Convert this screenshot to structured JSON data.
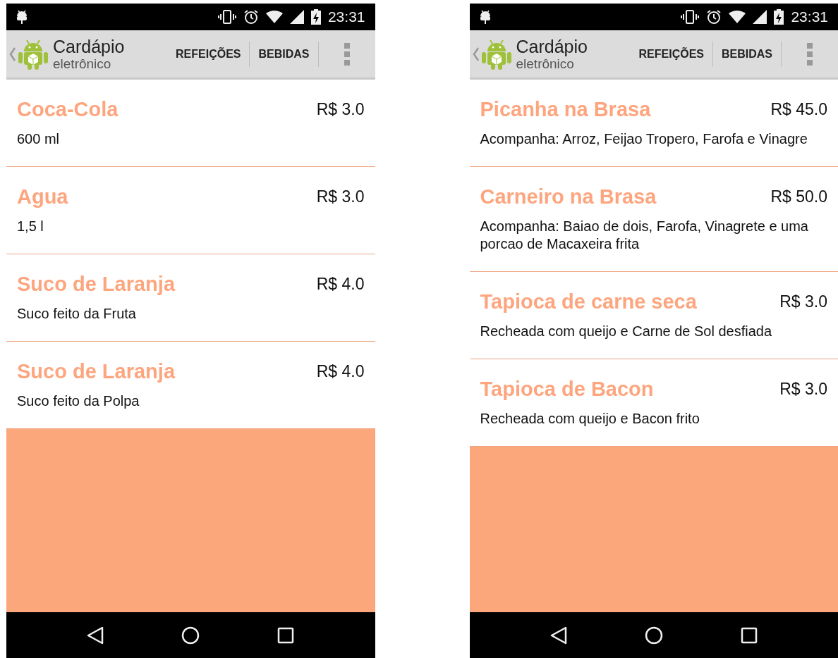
{
  "phones": [
    {
      "status_bar": {
        "time": "23:31"
      },
      "action_bar": {
        "title": "Cardápio",
        "subtitle": "eletrônico",
        "tabs": [
          "REFEIÇÕES",
          "BEBIDAS"
        ]
      },
      "items": [
        {
          "name": "Coca-Cola",
          "price": "R$ 3.0",
          "description": "600 ml"
        },
        {
          "name": "Agua",
          "price": "R$ 3.0",
          "description": "1,5 l"
        },
        {
          "name": "Suco de Laranja",
          "price": "R$ 4.0",
          "description": "Suco feito da Fruta"
        },
        {
          "name": "Suco de Laranja",
          "price": "R$ 4.0",
          "description": "Suco feito da Polpa"
        }
      ]
    },
    {
      "status_bar": {
        "time": "23:31"
      },
      "action_bar": {
        "title": "Cardápio",
        "subtitle": "eletrônico",
        "tabs": [
          "REFEIÇÕES",
          "BEBIDAS"
        ]
      },
      "items": [
        {
          "name": "Picanha na Brasa",
          "price": "R$ 45.0",
          "description": "Acompanha: Arroz, Feijao Tropero, Farofa e Vinagre"
        },
        {
          "name": "Carneiro na Brasa",
          "price": "R$ 50.0",
          "description": "Acompanha: Baiao de dois, Farofa, Vinagrete e uma porcao de Macaxeira frita"
        },
        {
          "name": "Tapioca de carne seca",
          "price": "R$ 3.0",
          "description": "Recheada com queijo e Carne de Sol desfiada"
        },
        {
          "name": "Tapioca de Bacon",
          "price": "R$ 3.0",
          "description": "Recheada com queijo e Bacon frito"
        }
      ]
    }
  ]
}
